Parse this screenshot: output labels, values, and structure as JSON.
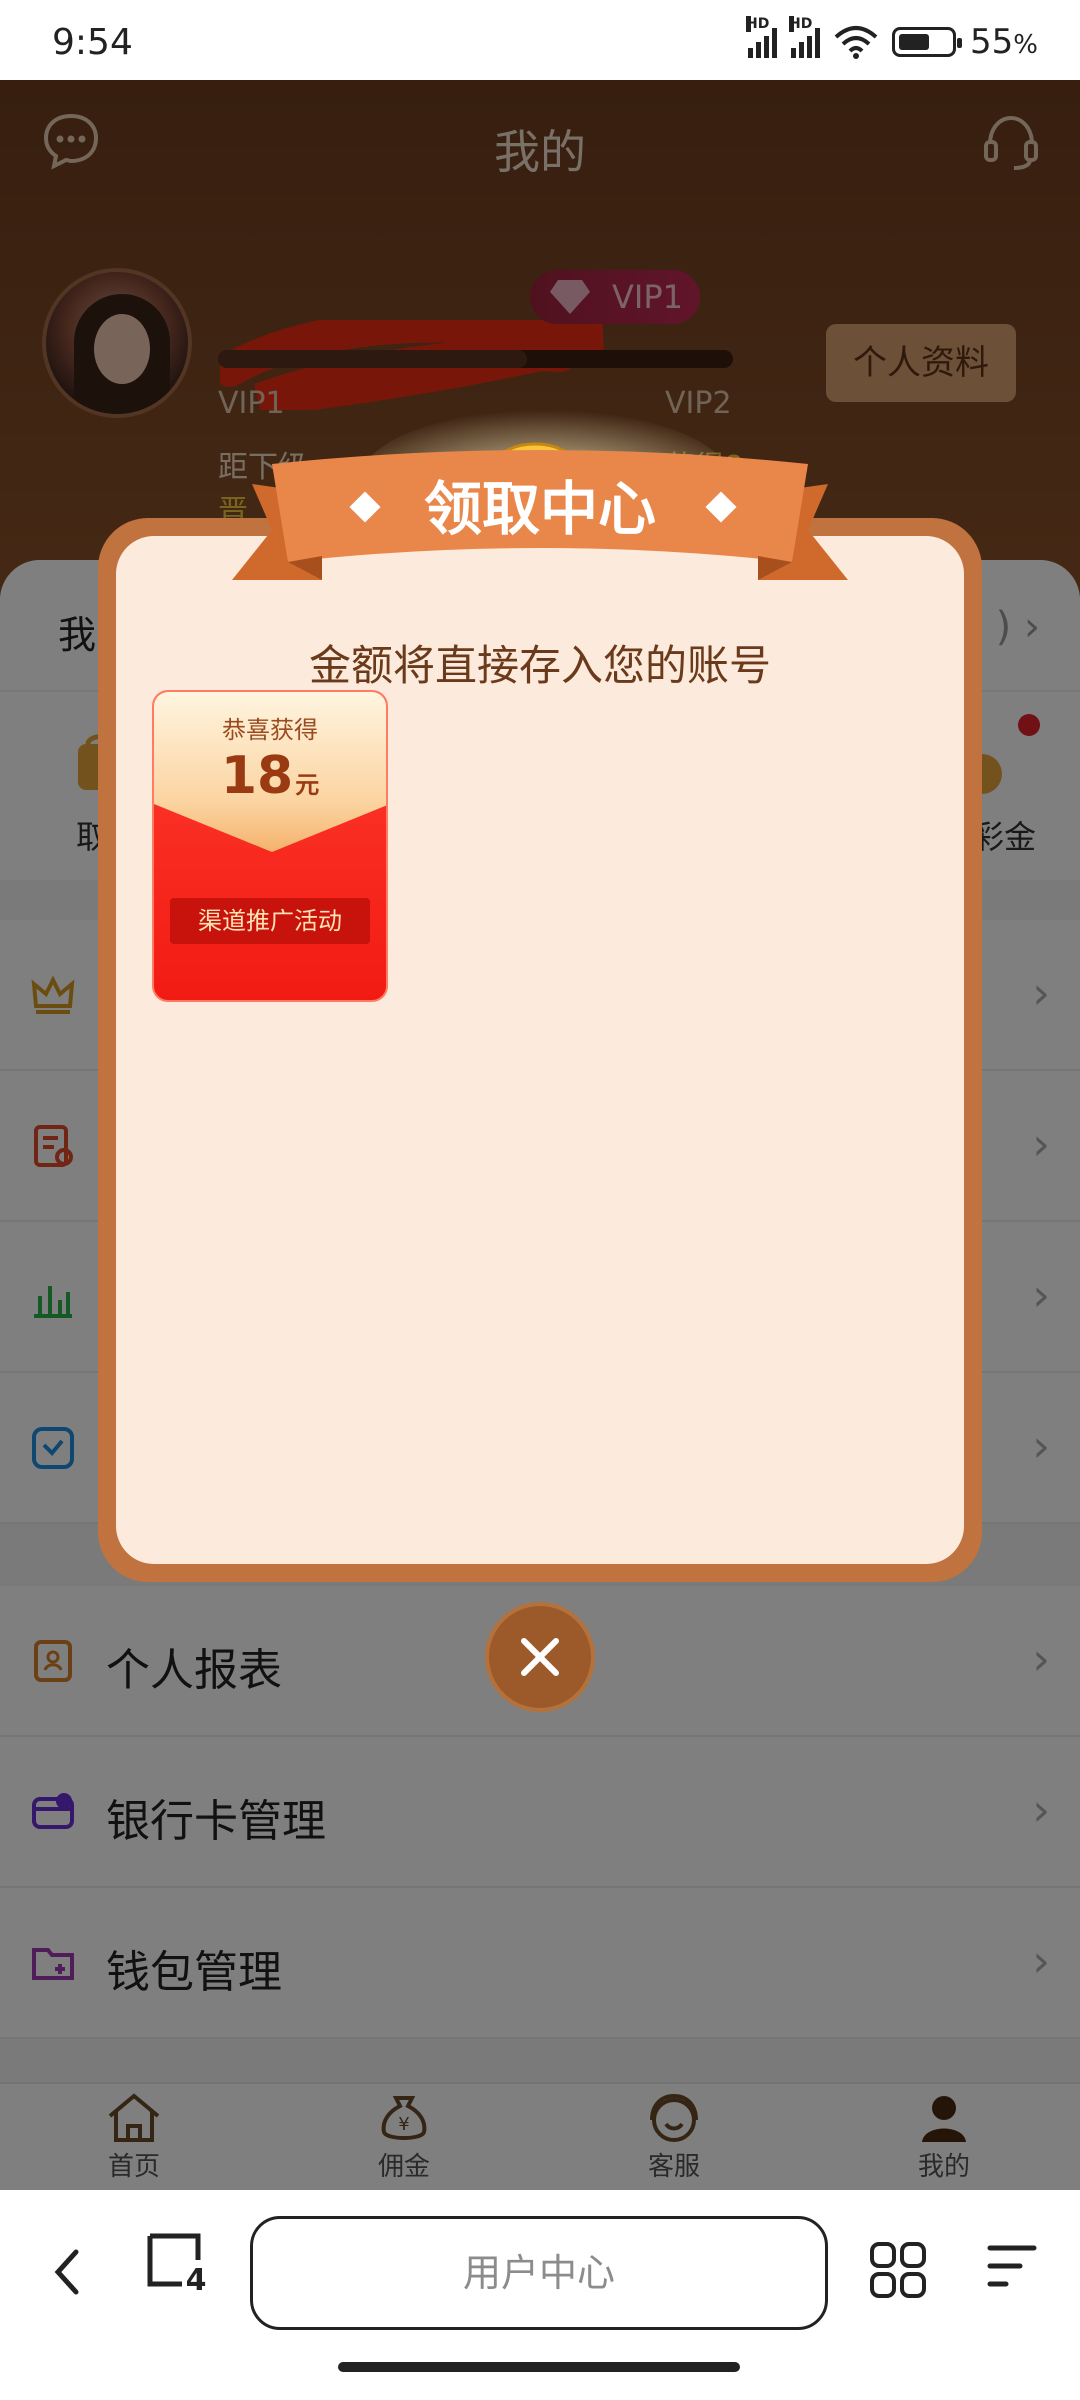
{
  "status_bar": {
    "time": "9:54",
    "signal1_tag": "HD",
    "signal2_tag": "HD",
    "battery_percent": "55",
    "battery_symbol": "%"
  },
  "header": {
    "title": "我的",
    "vip_badge": "VIP1",
    "profile_button": "个人资料",
    "current_level": "VIP1",
    "next_level": "VIP2",
    "next_level_text_start": "距下级",
    "next_level_text_end": "/IP2获得8",
    "next_level_line2": "晋",
    "progress": 0.6
  },
  "page": {
    "balance_label": "我",
    "balance_right": ")",
    "shortcut_left_label": "取",
    "shortcut_right_label": "彩金",
    "menu_items": [
      {
        "label": "个人报表"
      },
      {
        "label": "银行卡管理"
      },
      {
        "label": "钱包管理"
      }
    ]
  },
  "tabbar": {
    "tabs": [
      {
        "label": "首页"
      },
      {
        "label": "佣金"
      },
      {
        "label": "客服"
      },
      {
        "label": "我的"
      }
    ]
  },
  "browser": {
    "url_text": "用户中心",
    "tab_count": "4"
  },
  "modal": {
    "title": "领取中心",
    "subtitle": "金额将直接存入您的账号",
    "reward": {
      "congrats": "恭喜获得",
      "amount": "18",
      "unit": "元",
      "tag": "渠道推广活动"
    }
  },
  "colors": {
    "header_brown": "#6e3d1e",
    "modal_frame": "#c0733f",
    "modal_bg": "#fcebdc",
    "ribbon": "#e9874a",
    "reward_red": "#f21b13"
  }
}
